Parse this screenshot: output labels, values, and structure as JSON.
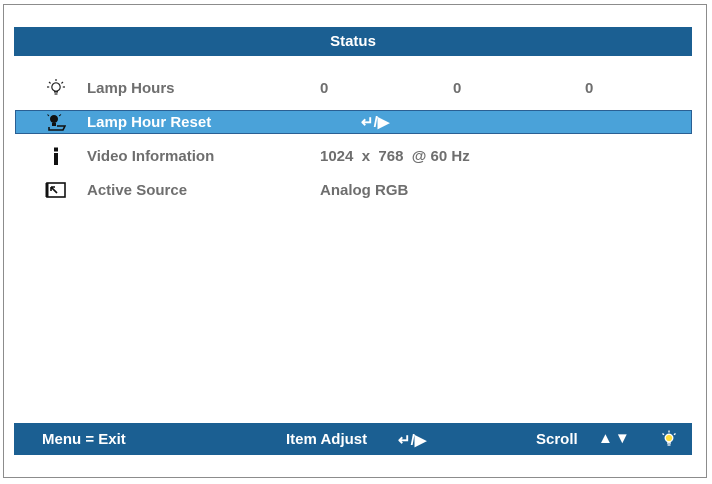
{
  "colors": {
    "bar_blue": "#1b5f92",
    "selected_row": "#4aa2d9",
    "text_gray": "#6e6e6e",
    "text_white": "#ffffff"
  },
  "header": {
    "title": "Status"
  },
  "rows": [
    {
      "icon": "lamp-hours-icon",
      "label": "Lamp Hours",
      "values": [
        "0",
        "0",
        "0"
      ]
    },
    {
      "icon": "lamp-reset-icon",
      "label": "Lamp Hour Reset",
      "values": [
        "↵/▶"
      ],
      "selected": true
    },
    {
      "icon": "info-icon",
      "label": "Video Information",
      "values": [
        "1024  x  768  @ 60 Hz"
      ]
    },
    {
      "icon": "source-icon",
      "label": "Active Source",
      "values": [
        "Analog RGB"
      ]
    }
  ],
  "footer": {
    "menu_exit": "Menu = Exit",
    "item_adjust": "Item Adjust",
    "adjust_glyph": "↵/▶",
    "scroll": "Scroll",
    "scroll_glyph": "▲▼",
    "hint_icon": "lamp-icon"
  }
}
